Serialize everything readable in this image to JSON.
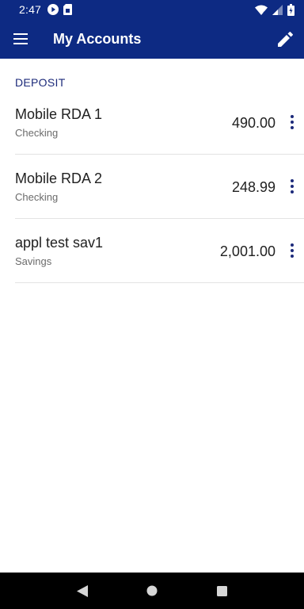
{
  "status_bar": {
    "time": "2:47",
    "icons": [
      "play-circle-icon",
      "sim-card-icon",
      "wifi-icon",
      "signal-icon",
      "battery-icon"
    ]
  },
  "app_bar": {
    "title": "My Accounts",
    "menu_icon": "hamburger-menu-icon",
    "edit_icon": "pencil-icon",
    "color": "#0d2a83"
  },
  "section": {
    "title": "DEPOSIT",
    "color": "#1c2a7a"
  },
  "accounts": [
    {
      "name": "Mobile RDA 1",
      "type": "Checking",
      "balance": "490.00"
    },
    {
      "name": "Mobile RDA 2",
      "type": "Checking",
      "balance": "248.99"
    },
    {
      "name": "appl test sav1",
      "type": "Savings",
      "balance": "2,001.00"
    }
  ],
  "nav_bar": {
    "buttons": [
      "back-icon",
      "home-icon",
      "recents-icon"
    ]
  }
}
